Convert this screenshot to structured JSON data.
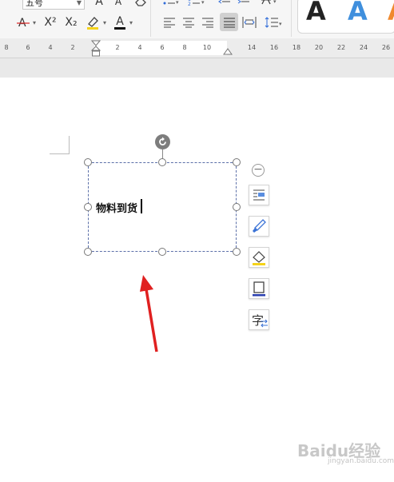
{
  "toolbar": {
    "font_size_value": "五号",
    "superscript_label": "X²",
    "subscript_label": "X₂",
    "font_color_label": "A",
    "highlight_label": "A",
    "grow_font_label": "A",
    "shrink_font_label": "A",
    "style_samples": [
      {
        "label": "A",
        "color": "#111111"
      },
      {
        "label": "A",
        "color": "#3f8fdd"
      },
      {
        "label": "A",
        "color": "#f0892e"
      }
    ]
  },
  "ruler": {
    "ticks": [
      "8",
      "6",
      "4",
      "2",
      "2",
      "4",
      "6",
      "8",
      "10",
      "14",
      "16",
      "18",
      "20",
      "22",
      "24",
      "26"
    ]
  },
  "textbox": {
    "text": "物料到货"
  },
  "side_tools": {
    "collapse_label": "−",
    "text_icon_label": "字"
  },
  "watermark": {
    "text": "Baidu经验",
    "sub": "jingyan.baidu.com"
  },
  "colors": {
    "arrow": "#e02020",
    "textbox_border": "#5b6fa8",
    "accent_blue": "#2f6bd8"
  }
}
